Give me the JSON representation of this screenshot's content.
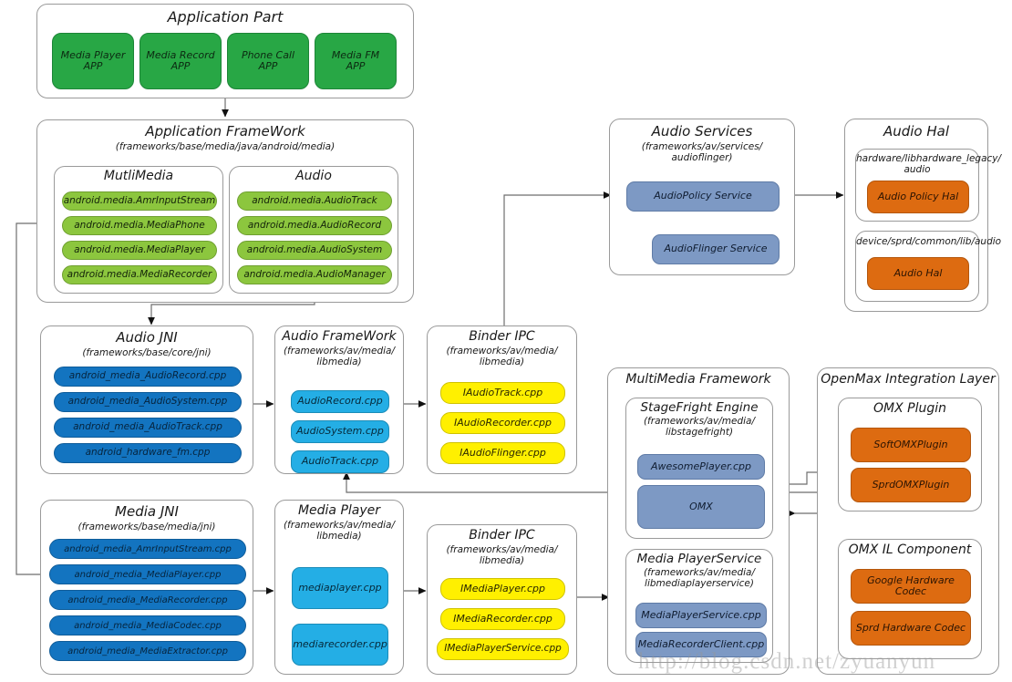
{
  "diagram": {
    "watermark": "http://blog.csdn.net/zyuanyun",
    "colors": {
      "app_green": "#28a745",
      "framework_green": "#8CC63E",
      "jni_blue": "#1374C0",
      "native_cyan": "#24AEE5",
      "binder_yellow": "#FFF000",
      "service_steel": "#7D99C4",
      "hal_orange": "#DD6B11",
      "container_border": "#9a9a9a"
    }
  },
  "application_part": {
    "title": "Application Part",
    "apps": [
      "Media Player\nAPP",
      "Media Record\nAPP",
      "Phone Call\nAPP",
      "Media FM\nAPP"
    ]
  },
  "application_framework": {
    "title": "Application FrameWork",
    "path": "(frameworks/base/media/java/android/media)",
    "multimedia": {
      "title": "MutliMedia",
      "items": [
        "android.media.AmrInputStream",
        "android.media.MediaPhone",
        "android.media.MediaPlayer",
        "android.media.MediaRecorder"
      ]
    },
    "audio": {
      "title": "Audio",
      "items": [
        "android.media.AudioTrack",
        "android.media.AudioRecord",
        "android.media.AudioSystem",
        "android.media.AudioManager"
      ]
    }
  },
  "audio_jni": {
    "title": "Audio JNI",
    "path": "(frameworks/base/core/jni)",
    "items": [
      "android_media_AudioRecord.cpp",
      "android_media_AudioSystem.cpp",
      "android_media_AudioTrack.cpp",
      "android_hardware_fm.cpp"
    ]
  },
  "audio_framework": {
    "title": "Audio FrameWork",
    "path": "(frameworks/av/media/\nlibmedia)",
    "items": [
      "AudioRecord.cpp",
      "AudioSystem.cpp",
      "AudioTrack.cpp"
    ]
  },
  "binder_ipc_audio": {
    "title": "Binder IPC",
    "path": "(frameworks/av/media/\nlibmedia)",
    "items": [
      "IAudioTrack.cpp",
      "IAudioRecorder.cpp",
      "IAudioFlinger.cpp"
    ]
  },
  "audio_services": {
    "title": "Audio Services",
    "path": "(frameworks/av/services/\naudioflinger)",
    "items": [
      "AudioPolicy Service",
      "AudioFlinger Service"
    ]
  },
  "audio_hal": {
    "title": "Audio Hal",
    "sections": [
      {
        "path": "hardware/libhardware_legacy/\naudio",
        "item": "Audio Policy Hal"
      },
      {
        "path": "device/sprd/common/lib/audio",
        "item": "Audio Hal"
      }
    ]
  },
  "media_jni": {
    "title": "Media JNI",
    "path": "(frameworks/base/media/jni)",
    "items": [
      "android_media_AmrInputStream.cpp",
      "android_media_MediaPlayer.cpp",
      "android_media_MediaRecorder.cpp",
      "android_media_MediaCodec.cpp",
      "android_media_MediaExtractor.cpp"
    ]
  },
  "media_player": {
    "title": "Media Player",
    "path": "(frameworks/av/media/\nlibmedia)",
    "items": [
      "mediaplayer.cpp",
      "mediarecorder.cpp"
    ]
  },
  "binder_ipc_media": {
    "title": "Binder IPC",
    "path": "(frameworks/av/media/\nlibmedia)",
    "items": [
      "IMediaPlayer.cpp",
      "IMediaRecorder.cpp",
      "IMediaPlayerService.cpp"
    ]
  },
  "multimedia_framework": {
    "title": "MultiMedia Framework",
    "stagefright": {
      "title": "StageFright Engine",
      "path": "(frameworks/av/media/\nlibstagefright)",
      "items": [
        "AwesomePlayer.cpp",
        "OMX"
      ]
    },
    "media_player_service": {
      "title": "Media PlayerService",
      "path": "(frameworks/av/media/\nlibmediaplayerservice)",
      "items": [
        "MediaPlayerService.cpp",
        "MediaRecorderClient.cpp"
      ]
    }
  },
  "openmax": {
    "title": "OpenMax Integration Layer",
    "omx_plugin": {
      "title": "OMX Plugin",
      "items": [
        "SoftOMXPlugin",
        "SprdOMXPlugin"
      ]
    },
    "omx_il_component": {
      "title": "OMX IL Component",
      "items": [
        "Google Hardware Codec",
        "Sprd Hardware Codec"
      ]
    }
  }
}
